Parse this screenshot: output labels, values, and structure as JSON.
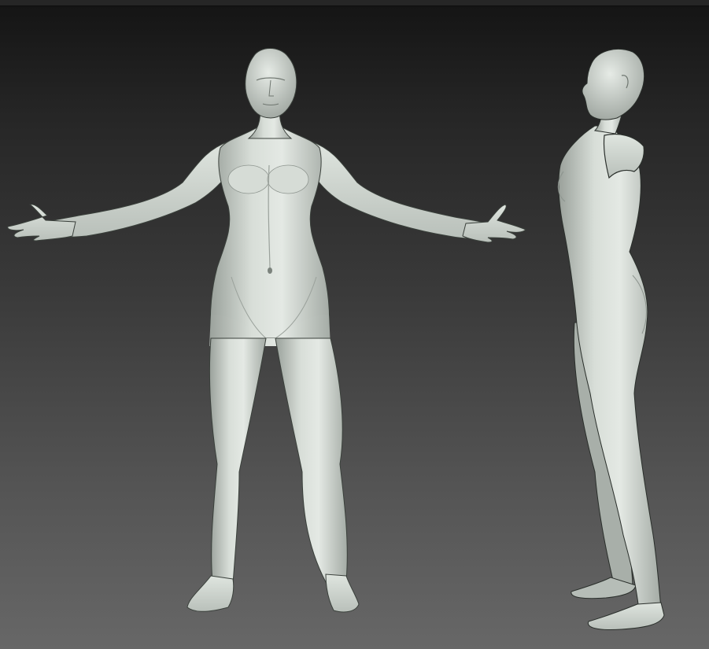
{
  "viewport": {
    "models": [
      {
        "view": "front"
      },
      {
        "view": "side"
      }
    ]
  },
  "colors": {
    "skin": "#c9d0c9",
    "skin_light": "#e2e8e2",
    "skin_shadow": "#8e958f",
    "background_top": "#141414",
    "background_bottom": "#676767",
    "outline": "#2a2f2b"
  }
}
